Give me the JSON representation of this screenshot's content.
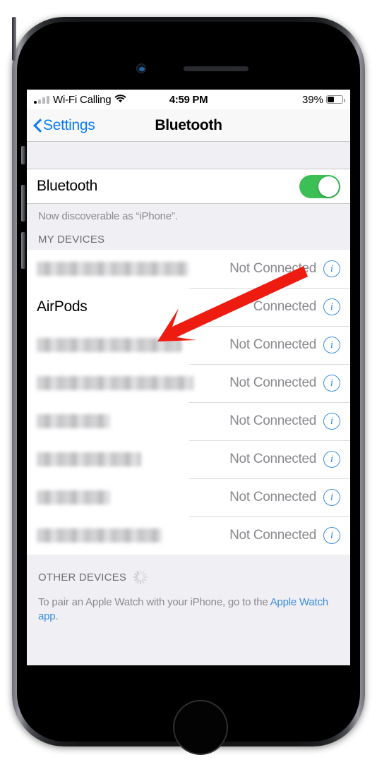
{
  "status_bar": {
    "carrier": "Wi-Fi Calling",
    "wifi_icon": "wifi-icon",
    "time": "4:59 PM",
    "battery_percent": "39%",
    "battery_level": 39
  },
  "nav_bar": {
    "back_label": "Settings",
    "title": "Bluetooth"
  },
  "bluetooth": {
    "label": "Bluetooth",
    "toggle_state": "on",
    "toggle_color": "#3cbf54",
    "discoverable_note": "Now discoverable as “iPhone”."
  },
  "my_devices": {
    "header": "MY DEVICES",
    "devices": [
      {
        "name": "",
        "redacted": true,
        "name_width": 215,
        "status": "Not Connected",
        "info": "i"
      },
      {
        "name": "AirPods",
        "redacted": false,
        "name_width": 90,
        "status": "Connected",
        "info": "i"
      },
      {
        "name": "",
        "redacted": true,
        "name_width": 205,
        "status": "Not Connected",
        "info": "i"
      },
      {
        "name": "",
        "redacted": true,
        "name_width": 222,
        "status": "Not Connected",
        "info": "i"
      },
      {
        "name": "",
        "redacted": true,
        "name_width": 104,
        "status": "Not Connected",
        "info": "i"
      },
      {
        "name": "",
        "redacted": true,
        "name_width": 148,
        "status": "Not Connected",
        "info": "i"
      },
      {
        "name": "",
        "redacted": true,
        "name_width": 104,
        "status": "Not Connected",
        "info": "i"
      },
      {
        "name": "",
        "redacted": true,
        "name_width": 177,
        "status": "Not Connected",
        "info": "i"
      }
    ]
  },
  "other_devices": {
    "header": "OTHER DEVICES",
    "spinner": "loading-spinner-icon",
    "footer_text": "To pair an Apple Watch with your iPhone, go to the ",
    "footer_link": "Apple Watch app",
    "footer_end": "."
  },
  "annotation": {
    "arrow": "red-arrow-callout",
    "arrow_color": "#ee1b11",
    "points_at": "AirPods"
  },
  "device_frame": {
    "kind": "iphone",
    "earpiece": "earpiece-speaker",
    "camera": "front-camera",
    "home_button": "home-button"
  }
}
